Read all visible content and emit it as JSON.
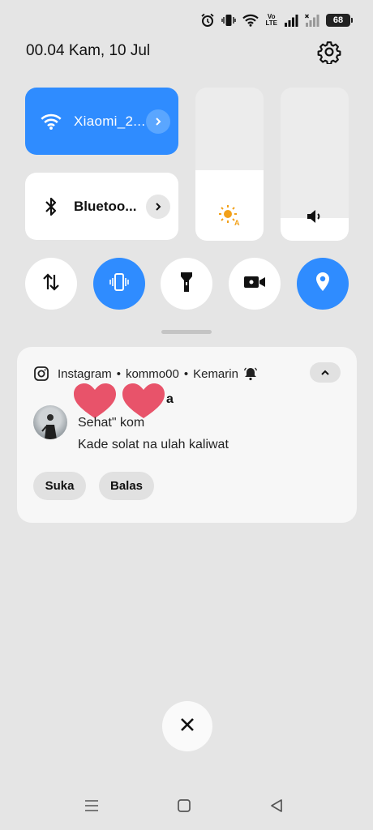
{
  "status_bar": {
    "icons": [
      "alarm-icon",
      "vibrate-icon",
      "wifi-icon",
      "volte-icon",
      "signal-icon",
      "signal-noservice-icon"
    ],
    "volte_label": "Vo\nLTE",
    "battery": "68"
  },
  "header": {
    "datetime": "00.04  Kam, 10 Jul",
    "settings_icon": "gear-icon"
  },
  "tiles": {
    "wifi": {
      "label": "Xiaomi_2...",
      "icon": "wifi-icon",
      "active": true
    },
    "bluetooth": {
      "label": "Bluetoo...",
      "icon": "bluetooth-icon",
      "active": false
    }
  },
  "sliders": {
    "brightness": {
      "icon": "brightness-auto-icon",
      "level": 0.46
    },
    "volume": {
      "icon": "speaker-icon",
      "level": 0.15
    }
  },
  "toggles": [
    {
      "name": "mobile-data",
      "icon": "data-arrows-icon",
      "active": false
    },
    {
      "name": "vibrate",
      "icon": "vibrate-icon",
      "active": true
    },
    {
      "name": "flashlight",
      "icon": "flashlight-icon",
      "active": false
    },
    {
      "name": "screen-record",
      "icon": "video-camera-icon",
      "active": false
    },
    {
      "name": "location",
      "icon": "location-pin-icon",
      "active": true
    }
  ],
  "notification": {
    "app": "Instagram",
    "account": "kommo00",
    "time": "Kemarin",
    "sender": "a",
    "line1": "Sehat\" kom",
    "line2": "Kade solat na ulah kaliwat",
    "actions": {
      "like": "Suka",
      "reply": "Balas"
    }
  },
  "colors": {
    "accent": "#2f8cff",
    "background": "#e5e5e5",
    "heart": "#e8536a",
    "sun": "#f2a11a"
  }
}
